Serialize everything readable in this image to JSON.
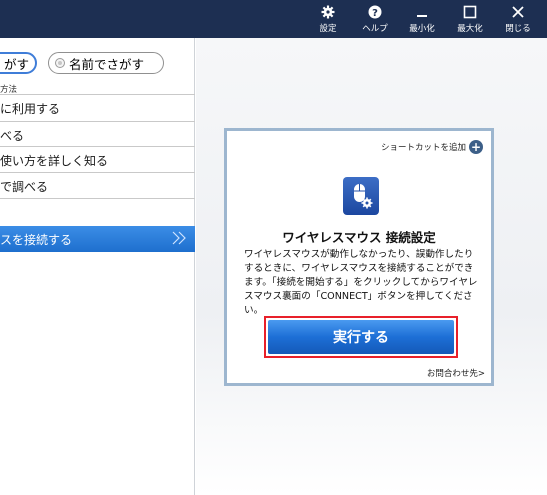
{
  "titlebar": {
    "settings_label": "設定",
    "help_label": "ヘルプ",
    "minimize_label": "最小化",
    "maximize_label": "最大化",
    "close_label": "閉じる"
  },
  "left": {
    "search_tab_1": "がす",
    "search_tab_2": "名前でさがす",
    "section_label": "方法",
    "items": [
      {
        "label": "に利用する"
      },
      {
        "label": "べる"
      },
      {
        "label": "使い方を詳しく知る"
      },
      {
        "label": "で調べる"
      },
      {
        "label": "スを接続する"
      }
    ]
  },
  "card": {
    "shortcut_label": "ショートカットを追加",
    "title": "ワイヤレスマウス 接続設定",
    "body": "ワイヤレスマウスが動作しなかったり、誤動作したりするときに、ワイヤレスマウスを接続することができます。「接続を開始する」をクリックしてからワイヤレスマウス裏面の「CONNECT」ボタンを押してください。",
    "execute_label": "実行する",
    "contact_label": "お問合わせ先>"
  },
  "colors": {
    "titlebar": "#1d2f52",
    "selected_item": "#2a7dd9",
    "execute_button": "#1d6fd6",
    "highlight_border": "#e8202a"
  }
}
